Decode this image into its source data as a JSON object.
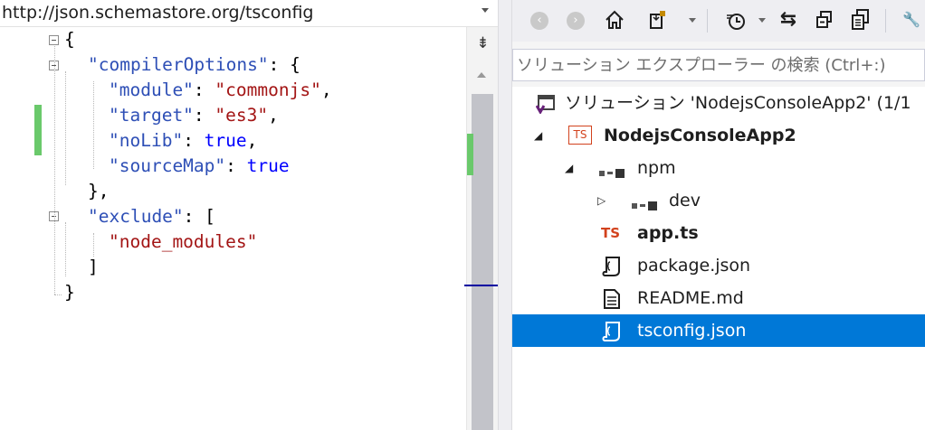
{
  "editor": {
    "schema_url": "http://json.schemastore.org/tsconfig",
    "split_icon": "⇟",
    "code_lines": [
      {
        "parts": [
          {
            "t": "{",
            "c": "p"
          }
        ]
      },
      {
        "parts": [
          {
            "t": "\"compilerOptions\"",
            "c": "key"
          },
          {
            "t": ": {",
            "c": "p"
          }
        ]
      },
      {
        "parts": [
          {
            "t": "\"module\"",
            "c": "key"
          },
          {
            "t": ": ",
            "c": "p"
          },
          {
            "t": "\"commonjs\"",
            "c": "str"
          },
          {
            "t": ",",
            "c": "p"
          }
        ]
      },
      {
        "parts": [
          {
            "t": "\"target\"",
            "c": "key"
          },
          {
            "t": ": ",
            "c": "p"
          },
          {
            "t": "\"es3\"",
            "c": "str"
          },
          {
            "t": ",",
            "c": "p"
          }
        ]
      },
      {
        "parts": [
          {
            "t": "\"noLib\"",
            "c": "key"
          },
          {
            "t": ": ",
            "c": "p"
          },
          {
            "t": "true",
            "c": "kw"
          },
          {
            "t": ",",
            "c": "p"
          }
        ]
      },
      {
        "parts": [
          {
            "t": "\"sourceMap\"",
            "c": "key"
          },
          {
            "t": ": ",
            "c": "p"
          },
          {
            "t": "true",
            "c": "kw"
          }
        ]
      },
      {
        "parts": [
          {
            "t": "},",
            "c": "p"
          }
        ]
      },
      {
        "parts": [
          {
            "t": "\"exclude\"",
            "c": "key"
          },
          {
            "t": ": [",
            "c": "p"
          }
        ]
      },
      {
        "parts": [
          {
            "t": "\"node_modules\"",
            "c": "str"
          }
        ]
      },
      {
        "parts": [
          {
            "t": "]",
            "c": "p"
          }
        ]
      },
      {
        "parts": [
          {
            "t": "}",
            "c": "p"
          }
        ]
      }
    ]
  },
  "explorer": {
    "toolbar_icons": [
      "back-icon",
      "forward-icon",
      "home-icon",
      "sync-icon",
      "history-icon",
      "pending-changes-icon",
      "collapse-all-icon",
      "show-all-files-icon",
      "properties-icon"
    ],
    "search_placeholder": "ソリューション エクスプローラー の検索 (Ctrl+:)",
    "tree": [
      {
        "label": "ソリューション 'NodejsConsoleApp2' (1/1",
        "icon": "solution-icon",
        "expander": "",
        "bold": false,
        "selected": false
      },
      {
        "label": "NodejsConsoleApp2",
        "icon": "ts-project-icon",
        "expander": "◢",
        "bold": true,
        "selected": false
      },
      {
        "label": "npm",
        "icon": "npm-icon",
        "expander": "◢",
        "bold": false,
        "selected": false
      },
      {
        "label": "dev",
        "icon": "npm-icon",
        "expander": "▷",
        "bold": false,
        "selected": false
      },
      {
        "label": "app.ts",
        "icon": "ts-file-icon",
        "expander": "",
        "bold": true,
        "selected": false
      },
      {
        "label": "package.json",
        "icon": "json-file-icon",
        "expander": "",
        "bold": false,
        "selected": false
      },
      {
        "label": "README.md",
        "icon": "markdown-file-icon",
        "expander": "",
        "bold": false,
        "selected": false
      },
      {
        "label": "tsconfig.json",
        "icon": "json-file-icon",
        "expander": "",
        "bold": false,
        "selected": true
      }
    ],
    "ts_badge": "TS",
    "selection_color": "#0078d7"
  }
}
